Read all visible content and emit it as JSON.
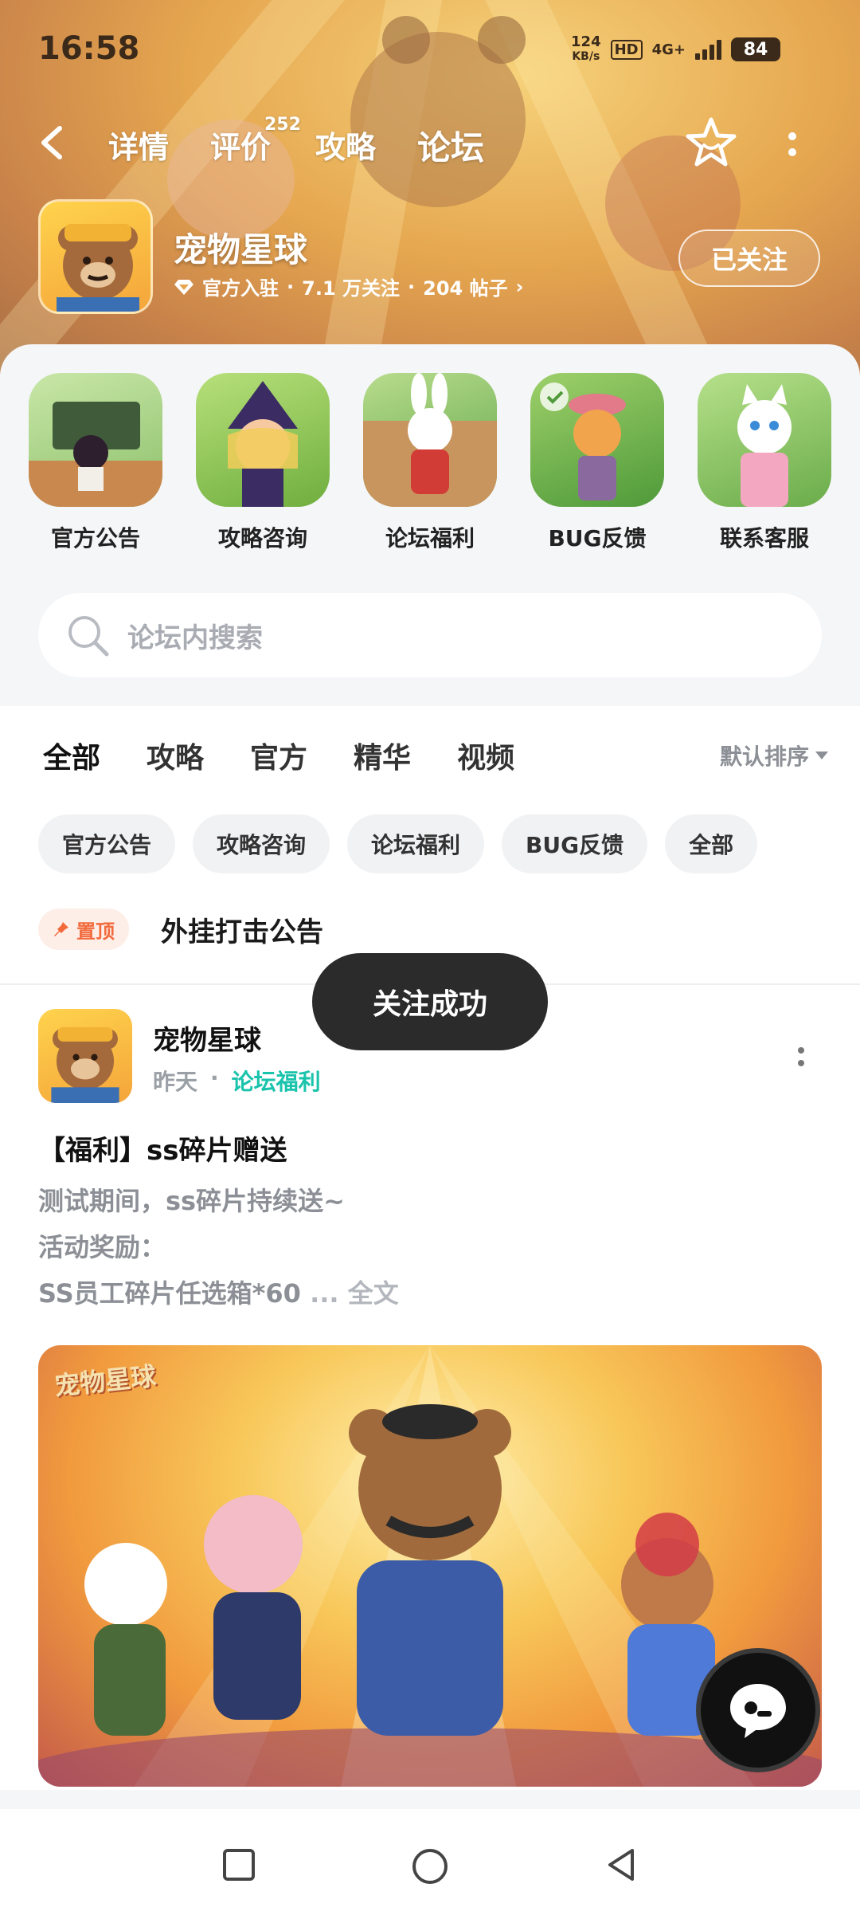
{
  "status_bar": {
    "time": "16:58",
    "net_speed_value": "124",
    "net_speed_unit": "KB/s",
    "hd": "HD",
    "network": "4G+",
    "battery": "84"
  },
  "navbar": {
    "tabs": [
      {
        "label": "详情"
      },
      {
        "label": "评价",
        "count": "252"
      },
      {
        "label": "攻略"
      },
      {
        "label": "论坛",
        "active": true
      }
    ]
  },
  "game": {
    "name": "宠物星球",
    "official": "官方入驻",
    "followers": "7.1 万关注",
    "posts": "204 帖子",
    "follow_label": "已关注"
  },
  "categories": [
    {
      "label": "官方公告"
    },
    {
      "label": "攻略咨询"
    },
    {
      "label": "论坛福利"
    },
    {
      "label": "BUG反馈"
    },
    {
      "label": "联系客服"
    }
  ],
  "search": {
    "placeholder": "论坛内搜索"
  },
  "feed": {
    "tabs": [
      "全部",
      "攻略",
      "官方",
      "精华",
      "视频"
    ],
    "sort_label": "默认排序",
    "chips": [
      "官方公告",
      "攻略咨询",
      "论坛福利",
      "BUG反馈",
      "全部"
    ],
    "pinned": {
      "badge": "置顶",
      "title": "外挂打击公告"
    },
    "post": {
      "author": "宠物星球",
      "time": "昨天",
      "separator": "·",
      "tag": "论坛福利",
      "title": "【福利】ss碎片赠送",
      "body_lines": [
        "测试期间，ss碎片持续送~",
        "活动奖励：",
        "SS员工碎片任选箱*60"
      ],
      "ellipsis": "...",
      "more_text": "全文",
      "image_brand": "宠物星球"
    }
  },
  "toast": "关注成功",
  "colors": {
    "accent": "#2fd3c0",
    "tag_color": "#19c3ac",
    "pin_color": "#f26a3c"
  }
}
